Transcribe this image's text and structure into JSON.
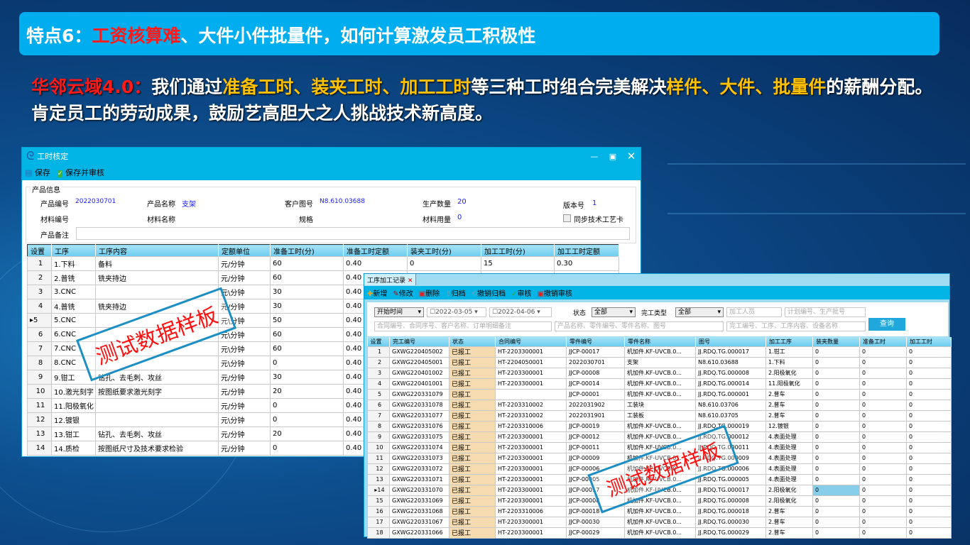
{
  "header": {
    "title_prefix": "特点6：",
    "title_red": "工资核算难",
    "title_rest": "、大件小件批量件，如何计算激发员工积极性"
  },
  "subtitle": {
    "brand": "华邻云域4.0：",
    "p1": "我们通过",
    "h1": "准备工时、装夹工时、加工工时",
    "p2": "等三种工时组合完美解决",
    "h2": "样件、大件、批量件",
    "p3": "的薪酬分配。肯定员工的劳动成果，鼓励艺高胆大之人挑战技术新高度。"
  },
  "colors": {
    "accent": "#00aeef",
    "highlight": "#ffc000",
    "brand_red": "#ff1a1a",
    "status_bg": "#f6dbb0"
  },
  "left_window": {
    "title": "工时核定",
    "toolbar": {
      "save": "保存",
      "save_audit": "保存并审核"
    },
    "group_title": "产品信息",
    "fields": {
      "product_no_label": "产品编号",
      "product_no": "2022030701",
      "product_name_label": "产品名称",
      "product_name": "支架",
      "customer_drawing_label": "客户图号",
      "customer_drawing": "N8.610.03688",
      "qty_label": "生产数量",
      "qty": "20",
      "version_label": "版本号",
      "version": "1",
      "material_no_label": "材料编号",
      "material_name_label": "材料名称",
      "spec_label": "规格",
      "material_qty_label": "材料用量",
      "material_qty": "0",
      "sync_label": "同步技术工艺卡",
      "remark_label": "产品备注"
    },
    "columns": [
      "设置",
      "工序",
      "工序内容",
      "定额单位",
      "准备工时(分)",
      "准备工时定额",
      "装夹工时(分)",
      "加工工时(分)",
      "加工工时定额"
    ],
    "rows": [
      [
        "1",
        "1.下料",
        "备料",
        "元/分钟",
        "60",
        "0.40",
        "0",
        "15",
        "0.30"
      ],
      [
        "2",
        "2.普铣",
        "铣夹持边",
        "元/分钟",
        "60",
        "0.40",
        "",
        "",
        ""
      ],
      [
        "3",
        "3.CNC",
        "",
        "元\\分钟",
        "30",
        "0.40",
        "",
        "",
        ""
      ],
      [
        "4",
        "4.普铣",
        "铣夹持边",
        "元/分钟",
        "30",
        "0.40",
        "",
        "",
        ""
      ],
      [
        "5",
        "5.CNC",
        "",
        "元\\分钟",
        "50",
        "0.40",
        "",
        "",
        ""
      ],
      [
        "6",
        "6.CNC",
        "",
        "元\\分钟",
        "60",
        "0.40",
        "",
        "",
        ""
      ],
      [
        "7",
        "7.CNC",
        "",
        "元\\分钟",
        "60",
        "0.40",
        "",
        "",
        ""
      ],
      [
        "8",
        "8.CNC",
        "",
        "元\\分钟",
        "0",
        "0.40",
        "",
        "",
        ""
      ],
      [
        "9",
        "9.钳工",
        "钻孔、去毛刺、攻丝",
        "元/分钟",
        "30",
        "0.40",
        "",
        "",
        ""
      ],
      [
        "10",
        "10.激光刻字",
        "按图纸要求激光刻字",
        "元/分钟",
        "20",
        "0.40",
        "",
        "",
        ""
      ],
      [
        "11",
        "11.阳极氧化",
        "",
        "元/分钟",
        "0",
        "0.40",
        "",
        "",
        ""
      ],
      [
        "12",
        "12.镀银",
        "",
        "元\\分钟",
        "0",
        "0.40",
        "",
        "",
        ""
      ],
      [
        "13",
        "13.钳工",
        "钻孔、去毛刺、攻丝",
        "元/分钟",
        "20",
        "0.40",
        "",
        "",
        ""
      ],
      [
        "14",
        "14.质检",
        "按图纸尺寸及技术要求检验",
        "元/分钟",
        "0",
        "0.40",
        "",
        "",
        ""
      ]
    ],
    "stamp": "测试数据样板"
  },
  "right_window": {
    "tab": "工序加工记录",
    "toolbar": [
      "新增",
      "修改",
      "删除",
      "归档",
      "撤销归档",
      "审核",
      "撤销审核"
    ],
    "filters": {
      "time_type": "开始时间",
      "date_from": "2022-03-05",
      "date_to": "2022-04-06",
      "status_label": "状态",
      "status": "全部",
      "type_label": "完工类型",
      "type": "全部",
      "worker_ph": "加工人员",
      "plan_ph": "计划编号、生产批号",
      "contract_ph": "合同编号、合同序号、客户名称、订单明细备注",
      "product_ph": "产品名称、零件编号、零件名称、图号",
      "process_ph": "完工编号、工序、工序内容、设备名称",
      "query": "查询"
    },
    "columns": [
      "设置",
      "完工编号",
      "状态",
      "合同编号",
      "零件编号",
      "零件名称",
      "图号",
      "加工工序",
      "装夹数量",
      "准备工时",
      "加工工时"
    ],
    "rows": [
      [
        "1",
        "GXWG220405002",
        "已报工",
        "HT-2203300001",
        "JJCP-00017",
        "机加件.KF-UVCB.0...",
        "JJ.RDQ.TG.000017",
        "1.钳工",
        "0",
        "0",
        "0"
      ],
      [
        "2",
        "GXWG220405001",
        "已报工",
        "HT-2204050001",
        "2022030701",
        "支架",
        "N8.610.03688",
        "1.下料",
        "0",
        "0",
        "0"
      ],
      [
        "3",
        "GXWG220401002",
        "已报工",
        "HT-2203300001",
        "JJCP-00008",
        "机加件.KF-UVCB.0...",
        "JJ.RDQ.TG.000008",
        "2.阳极氧化",
        "0",
        "0",
        "0"
      ],
      [
        "4",
        "GXWG220401001",
        "已报工",
        "HT-2203300001",
        "JJCP-00014",
        "机加件.KF-UVCB.0...",
        "JJ.RDQ.TG.000014",
        "11.阳极氧化",
        "0",
        "0",
        "0"
      ],
      [
        "5",
        "GXWG220331079",
        "已报工",
        "",
        "JJCP-00001",
        "机加件.KF-UVCB.0...",
        "JJ.RDQ.TG.000001",
        "2.普车",
        "0",
        "0",
        "0"
      ],
      [
        "6",
        "GXWG220331078",
        "已报工",
        "HT-2203310002",
        "2022031902",
        "工装块",
        "N8.610.03706",
        "2.普车",
        "0",
        "0",
        "0"
      ],
      [
        "7",
        "GXWG220331077",
        "已报工",
        "HT-2203310002",
        "2022031901",
        "工装板",
        "N8.610.03705",
        "2.普车",
        "0",
        "0",
        "0"
      ],
      [
        "8",
        "GXWG220331076",
        "已报工",
        "HT-2203310006",
        "JJCP-00019",
        "机加件.KF-UVCB.0...",
        "JJ.RDQ.TG.000019",
        "12.镀银",
        "0",
        "0",
        "0"
      ],
      [
        "9",
        "GXWG220331075",
        "已报工",
        "HT-2203300001",
        "JJCP-00012",
        "机加件.KF-UVCB.0...",
        "JJ.RDQ.TG.000012",
        "4.表面处理",
        "0",
        "0",
        "0"
      ],
      [
        "10",
        "GXWG220331074",
        "已报工",
        "HT-2203300001",
        "JJCP-00011",
        "机加件.KF-UVCB.0...",
        "JJ.RDQ.TG.000011",
        "4.表面处理",
        "0",
        "0",
        "0"
      ],
      [
        "11",
        "GXWG220331073",
        "已报工",
        "HT-2203300001",
        "JJCP-00009",
        "机加件.KF-UVCB.0...",
        "JJ.RDQ.TG.000009",
        "4.表面处理",
        "0",
        "0",
        "0"
      ],
      [
        "12",
        "GXWG220331072",
        "已报工",
        "HT-2203300001",
        "JJCP-00006",
        "机加件.KF-UVCB.0...",
        "JJ.RDQ.TG.000006",
        "4.表面处理",
        "0",
        "0",
        "0"
      ],
      [
        "13",
        "GXWG220331071",
        "已报工",
        "HT-2203300001",
        "JJCP-00005",
        "机加件.KF-UVCB.0...",
        "JJ.RDQ.TG.000005",
        "4.表面处理",
        "0",
        "0",
        "0"
      ],
      [
        "14",
        "GXWG220331070",
        "已报工",
        "HT-2203300001",
        "JJCP-00017",
        "机加件.KF-UVCB.0...",
        "JJ.RDQ.TG.000017",
        "2.阳极氧化",
        "0",
        "0",
        "0"
      ],
      [
        "15",
        "GXWG220331069",
        "已报工",
        "HT-2203300001",
        "JJCP-00008",
        "机加件.KF-UVCB.0...",
        "JJ.RDQ.TG.000008",
        "2.阳极氧化",
        "0",
        "0",
        "0"
      ],
      [
        "16",
        "GXWG220331068",
        "已报工",
        "HT-2203310006",
        "JJCP-00018",
        "机加件.KF-UVCB.0...",
        "JJ.RDQ.TG.000018",
        "2.普车",
        "0",
        "0",
        "0"
      ],
      [
        "17",
        "GXWG220331067",
        "已报工",
        "HT-2203300001",
        "JJCP-00030",
        "机加件.KF-UVCB.0...",
        "JJ.RDQ.TG.000030",
        "2.普车",
        "0",
        "0",
        "0"
      ],
      [
        "18",
        "GXWG220331066",
        "已报工",
        "HT-2203300001",
        "JJCP-00029",
        "机加件.KF-UVCB.0...",
        "JJ.RDQ.TG.000029",
        "2.普车",
        "0",
        "0",
        "0"
      ]
    ],
    "stamp": "测试数据样板"
  }
}
